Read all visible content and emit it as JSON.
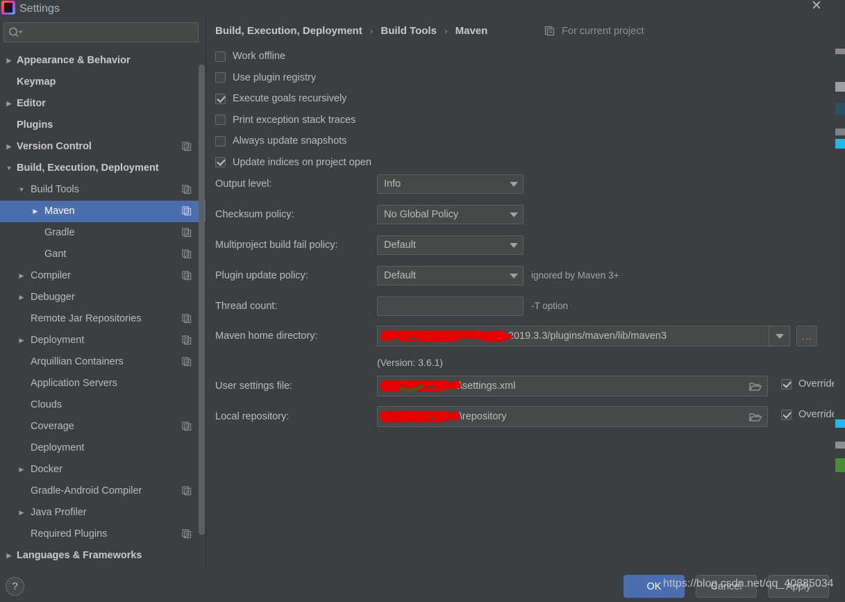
{
  "window": {
    "title": "Settings",
    "close_label": "✕",
    "app_icon": "intellij-idea-icon"
  },
  "search": {
    "value": "",
    "placeholder": "",
    "icon": "search-icon"
  },
  "sidebar": {
    "items": [
      {
        "label": "Appearance & Behavior",
        "depth": 0,
        "arrow": "right",
        "bold": true,
        "copy_icon": false,
        "selected": false
      },
      {
        "label": "Keymap",
        "depth": 0,
        "arrow": "none",
        "bold": true,
        "copy_icon": false,
        "selected": false
      },
      {
        "label": "Editor",
        "depth": 0,
        "arrow": "right",
        "bold": true,
        "copy_icon": false,
        "selected": false
      },
      {
        "label": "Plugins",
        "depth": 0,
        "arrow": "none",
        "bold": true,
        "copy_icon": false,
        "selected": false
      },
      {
        "label": "Version Control",
        "depth": 0,
        "arrow": "right",
        "bold": true,
        "copy_icon": true,
        "selected": false
      },
      {
        "label": "Build, Execution, Deployment",
        "depth": 0,
        "arrow": "down",
        "bold": true,
        "copy_icon": false,
        "selected": false
      },
      {
        "label": "Build Tools",
        "depth": 1,
        "arrow": "down",
        "bold": false,
        "copy_icon": true,
        "selected": false
      },
      {
        "label": "Maven",
        "depth": 2,
        "arrow": "right",
        "bold": false,
        "copy_icon": true,
        "selected": true
      },
      {
        "label": "Gradle",
        "depth": 2,
        "arrow": "none",
        "bold": false,
        "copy_icon": true,
        "selected": false
      },
      {
        "label": "Gant",
        "depth": 2,
        "arrow": "none",
        "bold": false,
        "copy_icon": true,
        "selected": false
      },
      {
        "label": "Compiler",
        "depth": 1,
        "arrow": "right",
        "bold": false,
        "copy_icon": true,
        "selected": false
      },
      {
        "label": "Debugger",
        "depth": 1,
        "arrow": "right",
        "bold": false,
        "copy_icon": false,
        "selected": false
      },
      {
        "label": "Remote Jar Repositories",
        "depth": 1,
        "arrow": "none",
        "bold": false,
        "copy_icon": true,
        "selected": false
      },
      {
        "label": "Deployment",
        "depth": 1,
        "arrow": "right",
        "bold": false,
        "copy_icon": true,
        "selected": false
      },
      {
        "label": "Arquillian Containers",
        "depth": 1,
        "arrow": "none",
        "bold": false,
        "copy_icon": true,
        "selected": false
      },
      {
        "label": "Application Servers",
        "depth": 1,
        "arrow": "none",
        "bold": false,
        "copy_icon": false,
        "selected": false
      },
      {
        "label": "Clouds",
        "depth": 1,
        "arrow": "none",
        "bold": false,
        "copy_icon": false,
        "selected": false
      },
      {
        "label": "Coverage",
        "depth": 1,
        "arrow": "none",
        "bold": false,
        "copy_icon": true,
        "selected": false
      },
      {
        "label": "Deployment",
        "depth": 1,
        "arrow": "none",
        "bold": false,
        "copy_icon": false,
        "selected": false
      },
      {
        "label": "Docker",
        "depth": 1,
        "arrow": "right",
        "bold": false,
        "copy_icon": false,
        "selected": false
      },
      {
        "label": "Gradle-Android Compiler",
        "depth": 1,
        "arrow": "none",
        "bold": false,
        "copy_icon": true,
        "selected": false
      },
      {
        "label": "Java Profiler",
        "depth": 1,
        "arrow": "right",
        "bold": false,
        "copy_icon": false,
        "selected": false
      },
      {
        "label": "Required Plugins",
        "depth": 1,
        "arrow": "none",
        "bold": false,
        "copy_icon": true,
        "selected": false
      },
      {
        "label": "Languages & Frameworks",
        "depth": 0,
        "arrow": "right",
        "bold": true,
        "copy_icon": false,
        "selected": false
      }
    ]
  },
  "content": {
    "breadcrumb": {
      "part1": "Build, Execution, Deployment",
      "sep1": "›",
      "part2": "Build Tools",
      "sep2": "›",
      "part3": "Maven"
    },
    "scope_note": "For current project",
    "scope_icon": "project-scope-icon",
    "checkboxes": [
      {
        "label": "Work offline",
        "checked": false
      },
      {
        "label": "Use plugin registry",
        "checked": false
      },
      {
        "label": "Execute goals recursively",
        "checked": true
      },
      {
        "label": "Print exception stack traces",
        "checked": false
      },
      {
        "label": "Always update snapshots",
        "checked": false
      },
      {
        "label": "Update indices on project open",
        "checked": true
      }
    ],
    "combos": [
      {
        "label": "Output level:",
        "value": "Info"
      },
      {
        "label": "Checksum policy:",
        "value": "No Global Policy"
      },
      {
        "label": "Multiproject build fail policy:",
        "value": "Default"
      },
      {
        "label": "Plugin update policy:",
        "value": "Default",
        "hint": "ignored by Maven 3+"
      }
    ],
    "thread_count": {
      "label": "Thread count:",
      "value": "",
      "hint": "-T option"
    },
    "maven_home": {
      "label": "Maven home directory:",
      "value": "IDEA 2019.3.3/plugins/maven/lib/maven3",
      "redacted": true,
      "browse_label": "...",
      "version": "(Version: 3.6.1)"
    },
    "user_settings": {
      "label": "User settings file:",
      "value": "\\.m2\\settings.xml",
      "redacted": true,
      "override_label": "Override",
      "override_checked": true,
      "folder_icon": "folder-open-icon"
    },
    "local_repository": {
      "label": "Local repository:",
      "value": "\\.m2\\repository",
      "redacted": true,
      "override_label": "Override",
      "override_checked": true,
      "folder_icon": "folder-open-icon"
    }
  },
  "footer": {
    "help_label": "?",
    "ok_label": "OK",
    "cancel_label": "Cancel",
    "apply_label": "Apply"
  },
  "watermark": "https://blog.csdn.net/qq_40885034",
  "colors": {
    "background": "#3c3f41",
    "selection": "#4b6eaf",
    "field": "#45494a",
    "border": "#5e6060",
    "text": "#bbbbbb",
    "redaction": "#e60000"
  }
}
